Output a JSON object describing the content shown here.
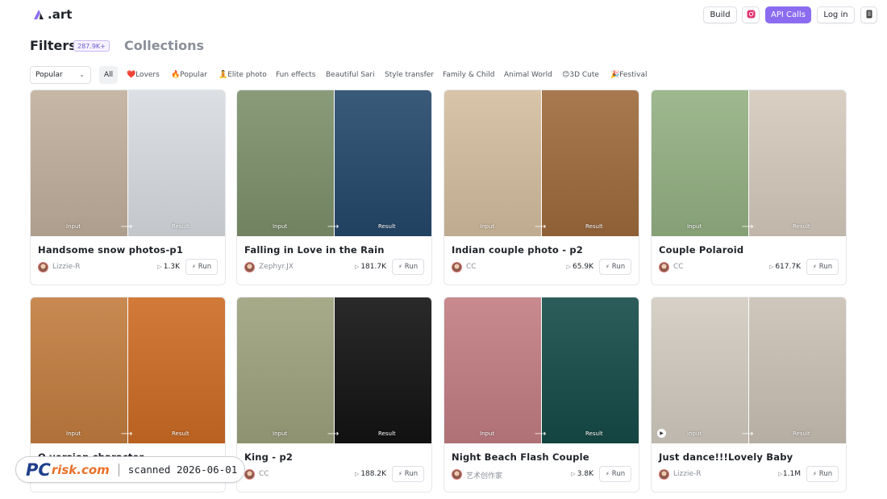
{
  "brand": {
    "name": ".art"
  },
  "header": {
    "build_label": "Build",
    "api_label": "API Calls",
    "login_label": "Log in"
  },
  "tabs": {
    "filters": "Filters",
    "filters_count": "287.9K+",
    "collections": "Collections"
  },
  "sort": {
    "selected": "Popular"
  },
  "categories": [
    "All",
    "❤️Lovers",
    "🔥Popular",
    "🧘Elite photo",
    "Fun effects",
    "Beautiful Sari",
    "Style transfer",
    "Family & Child",
    "Animal World",
    "😊3D Cute",
    "🎉Festival"
  ],
  "image_labels": {
    "input": "Input",
    "result": "Result"
  },
  "run_label": "Run",
  "cards": [
    {
      "title": "Handsome snow photos-p1",
      "author": "Lizzie-R",
      "runs": "1.3K",
      "colors": [
        "#c7b7a6",
        "#dcdfe3"
      ]
    },
    {
      "title": "Falling in Love in the Rain",
      "author": "Zephyr.JX",
      "runs": "181.7K",
      "colors": [
        "#8a9b7a",
        "#3a5a7a"
      ]
    },
    {
      "title": "Indian couple photo - p2",
      "author": "CC",
      "runs": "65.9K",
      "colors": [
        "#d8c4a8",
        "#a8794f"
      ]
    },
    {
      "title": "Couple Polaroid",
      "author": "CC",
      "runs": "617.7K",
      "colors": [
        "#9fb88f",
        "#d9cfc3"
      ]
    },
    {
      "title": "Q version character",
      "author": "",
      "runs": "",
      "colors": [
        "#c98a52",
        "#d27a3a"
      ]
    },
    {
      "title": "King - p2",
      "author": "CC",
      "runs": "188.2K",
      "colors": [
        "#a7ab8a",
        "#2a2a2a"
      ]
    },
    {
      "title": "Night Beach Flash Couple",
      "author": "艺术创作家",
      "runs": "3.8K",
      "colors": [
        "#c88a8e",
        "#2d5d5a"
      ]
    },
    {
      "title": "Just dance!!!Lovely Baby",
      "author": "Lizzie-R",
      "runs": "1.1M",
      "colors": [
        "#d6d0c6",
        "#cfc7bc"
      ]
    }
  ],
  "watermark": {
    "brand_pc": "PC",
    "brand_risk": "risk.com",
    "scanned": "scanned 2026-06-01"
  }
}
